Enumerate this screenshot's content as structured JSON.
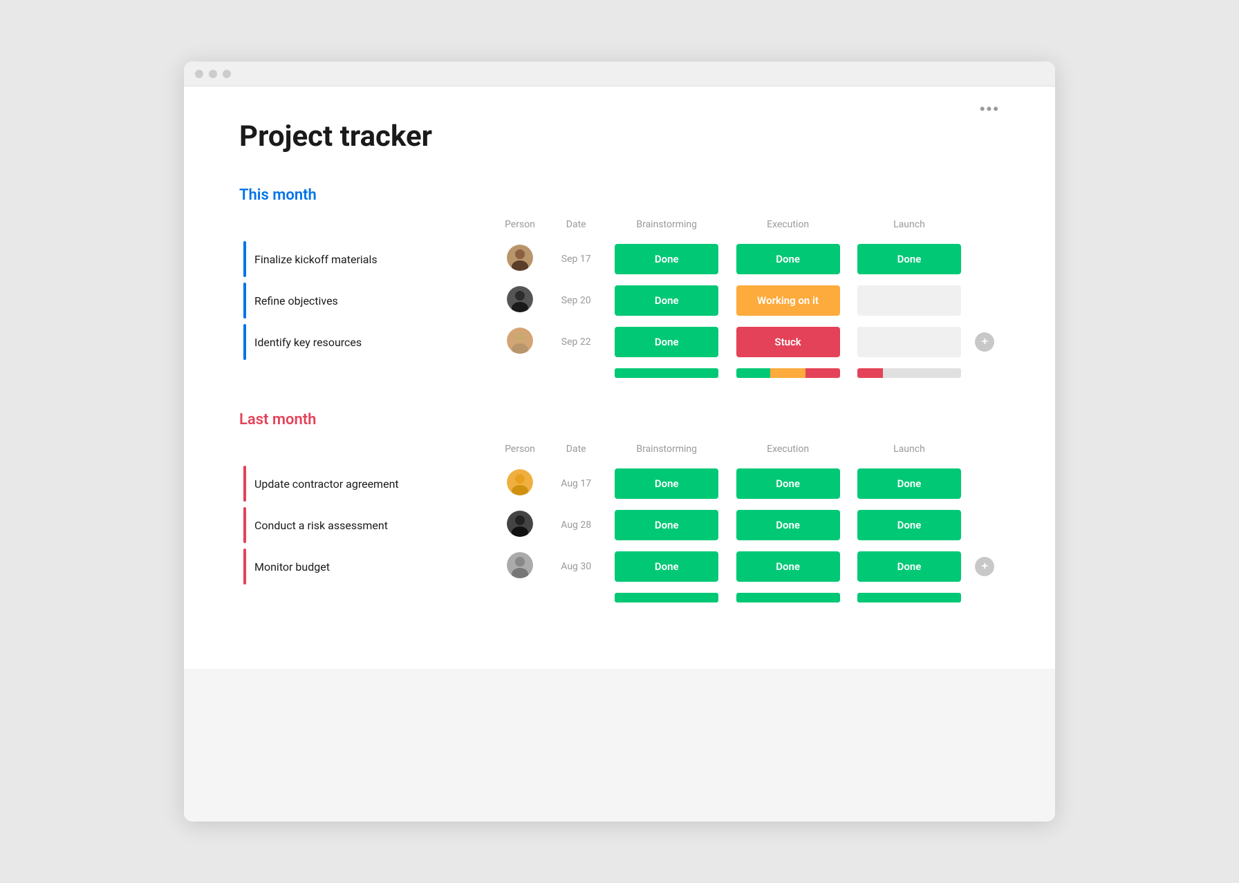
{
  "app": {
    "title": "Project tracker",
    "more_label": "•••"
  },
  "this_month": {
    "label": "This month",
    "columns": {
      "person": "Person",
      "date": "Date",
      "brainstorming": "Brainstorming",
      "execution": "Execution",
      "launch": "Launch"
    },
    "rows": [
      {
        "task": "Finalize kickoff materials",
        "date": "Sep 17",
        "brainstorming": "Done",
        "execution": "Done",
        "launch": "Done"
      },
      {
        "task": "Refine objectives",
        "date": "Sep 20",
        "brainstorming": "Done",
        "execution": "Working on it",
        "launch": ""
      },
      {
        "task": "Identify key resources",
        "date": "Sep 22",
        "brainstorming": "Done",
        "execution": "Stuck",
        "launch": ""
      }
    ],
    "summary": {
      "brainstorming": [
        {
          "color": "green",
          "pct": 100
        }
      ],
      "execution": [
        {
          "color": "green",
          "pct": 33
        },
        {
          "color": "orange",
          "pct": 34
        },
        {
          "color": "red",
          "pct": 33
        }
      ],
      "launch": [
        {
          "color": "red",
          "pct": 25
        },
        {
          "color": "gray",
          "pct": 75
        }
      ]
    }
  },
  "last_month": {
    "label": "Last month",
    "columns": {
      "person": "Person",
      "date": "Date",
      "brainstorming": "Brainstorming",
      "execution": "Execution",
      "launch": "Launch"
    },
    "rows": [
      {
        "task": "Update contractor agreement",
        "date": "Aug 17",
        "brainstorming": "Done",
        "execution": "Done",
        "launch": "Done"
      },
      {
        "task": "Conduct a risk assessment",
        "date": "Aug 28",
        "brainstorming": "Done",
        "execution": "Done",
        "launch": "Done"
      },
      {
        "task": "Monitor budget",
        "date": "Aug 30",
        "brainstorming": "Done",
        "execution": "Done",
        "launch": "Done"
      }
    ],
    "summary": {
      "brainstorming": [
        {
          "color": "green",
          "pct": 100
        }
      ],
      "execution": [
        {
          "color": "green",
          "pct": 100
        }
      ],
      "launch": [
        {
          "color": "green",
          "pct": 100
        }
      ]
    }
  },
  "avatars": {
    "this_month": [
      {
        "bg": "#5a3e2b",
        "label": "Person 1"
      },
      {
        "bg": "#2d2d2d",
        "label": "Person 2"
      },
      {
        "bg": "#c8a96e",
        "label": "Person 3"
      }
    ],
    "last_month": [
      {
        "bg": "#e8a020",
        "label": "Person 4"
      },
      {
        "bg": "#1a1a1a",
        "label": "Person 5"
      },
      {
        "bg": "#888",
        "label": "Person 6"
      }
    ]
  }
}
